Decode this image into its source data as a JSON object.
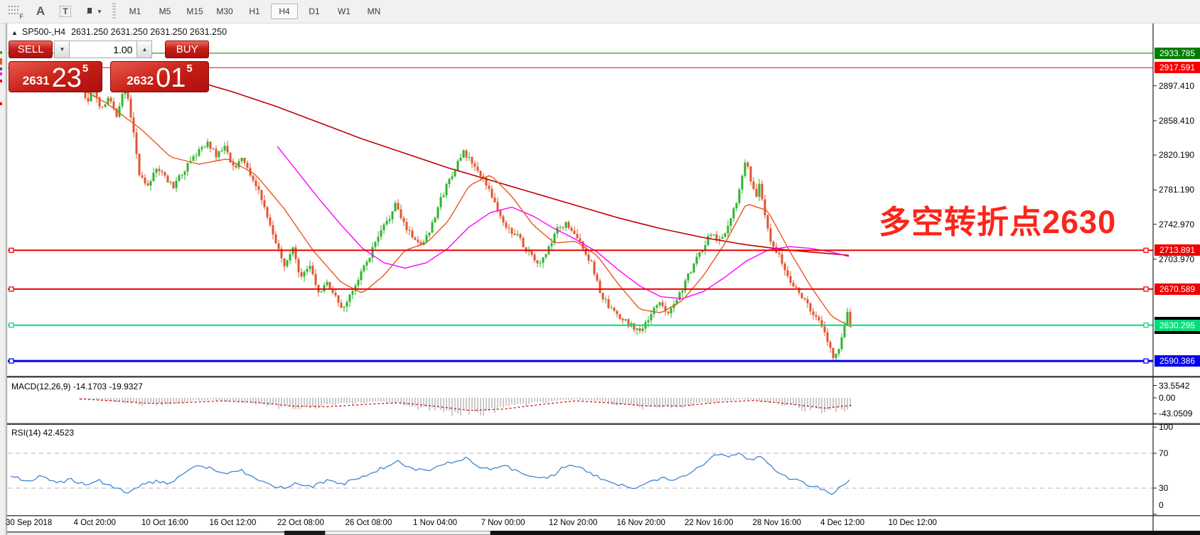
{
  "toolbar": {
    "icon_letters": {
      "f": "F",
      "a": "A",
      "t": "T"
    },
    "timeframes": [
      "M1",
      "M5",
      "M15",
      "M30",
      "H1",
      "H4",
      "D1",
      "W1",
      "MN"
    ],
    "active_timeframe": "H4"
  },
  "header": {
    "collapse_arrow": "▲",
    "symbol": "SP500-,H4",
    "ohlc_text": "2631.250 2631.250 2631.250 2631.250"
  },
  "trade_panel": {
    "sell_label": "SELL",
    "buy_label": "BUY",
    "volume": "1.00",
    "sell_price": {
      "prefix": "2631",
      "big": "23",
      "sup": "5"
    },
    "buy_price": {
      "prefix": "2632",
      "big": "01",
      "sup": "5"
    }
  },
  "annotation": {
    "text": "多空转折点2630",
    "color": "#fa261c"
  },
  "indicators": {
    "macd_label": "MACD(12,26,9) -14.1703 -19.9327",
    "rsi_label": "RSI(14) 42.4523"
  },
  "axes": {
    "price_ticks": [
      {
        "label": "2897.410",
        "price": 2897.41
      },
      {
        "label": "2858.410",
        "price": 2858.41
      },
      {
        "label": "2820.190",
        "price": 2820.19
      },
      {
        "label": "2781.190",
        "price": 2781.19
      },
      {
        "label": "2742.970",
        "price": 2742.97
      },
      {
        "label": "2703.970",
        "price": 2703.97
      }
    ],
    "price_badges": [
      {
        "label": "2933.785",
        "price": 2933.785,
        "color": "#007d00"
      },
      {
        "label": "2917.591",
        "price": 2917.591,
        "color": "#f40000"
      },
      {
        "label": "2713.891",
        "price": 2713.891,
        "color": "#ee0000"
      },
      {
        "label": "2670.589",
        "price": 2670.589,
        "color": "#ee0000"
      },
      {
        "label": "2630.295",
        "price": 2630.295,
        "color": "#00df7d",
        "backplate": true
      },
      {
        "label": "2590.386",
        "price": 2590.386,
        "color": "#0000ee"
      }
    ],
    "macd_ticks": [
      {
        "label": "33.5542",
        "value": 33.5542
      },
      {
        "label": "0.00",
        "value": 0
      },
      {
        "label": "-43.0509",
        "value": -43.0509
      }
    ],
    "rsi_ticks": [
      {
        "label": "100",
        "value": 100
      },
      {
        "label": "70",
        "value": 70
      },
      {
        "label": "30",
        "value": 30
      },
      {
        "label": "0",
        "value": 0
      }
    ],
    "dates": [
      "30 Sep 2018",
      "4 Oct 20:00",
      "10 Oct 16:00",
      "16 Oct 12:00",
      "22 Oct 08:00",
      "26 Oct 08:00",
      "1 Nov 04:00",
      "7 Nov 00:00",
      "12 Nov 20:00",
      "16 Nov 20:00",
      "22 Nov 16:00",
      "28 Nov 16:00",
      "4 Dec 12:00",
      "10 Dec 12:00"
    ]
  },
  "chart_data": {
    "type": "candlestick",
    "symbol": "SP500-",
    "timeframe": "H4",
    "last_price": 2631.25,
    "bid": 2631.235,
    "ask": 2632.015,
    "visible_price_range": [
      2573,
      2967
    ],
    "horizontal_levels": [
      {
        "price": 2933.785,
        "color": "#007d00",
        "width": 1,
        "handles": false
      },
      {
        "price": 2917.591,
        "color": "#f40000",
        "width": 1,
        "handles": false
      },
      {
        "price": 2713.891,
        "color": "#ee0000",
        "width": 2,
        "handles": true
      },
      {
        "price": 2670.589,
        "color": "#ee0000",
        "width": 2,
        "handles": true
      },
      {
        "price": 2630.295,
        "color": "#00df7d",
        "width": 2,
        "handles": true
      },
      {
        "price": 2590.386,
        "color": "#0000ee",
        "width": 3,
        "handles": true
      }
    ],
    "colors": {
      "up": "#2eb32e",
      "down": "#e2552e",
      "ma_fast": "#e8581e",
      "ma_mid": "#ff00ff",
      "ma_slow": "#c00000",
      "macd_hist": "#bcbcbc",
      "macd_signal": "#d40000",
      "rsi": "#3f86d2",
      "rsi_level": "#b5b5b5"
    },
    "price_path": [
      [
        112,
        2914
      ],
      [
        122,
        2880
      ],
      [
        132,
        2892
      ],
      [
        142,
        2870
      ],
      [
        152,
        2886
      ],
      [
        164,
        2866
      ],
      [
        176,
        2900
      ],
      [
        186,
        2856
      ],
      [
        196,
        2798
      ],
      [
        208,
        2788
      ],
      [
        220,
        2806
      ],
      [
        232,
        2794
      ],
      [
        244,
        2786
      ],
      [
        256,
        2800
      ],
      [
        268,
        2812
      ],
      [
        280,
        2826
      ],
      [
        292,
        2832
      ],
      [
        304,
        2820
      ],
      [
        316,
        2828
      ],
      [
        328,
        2806
      ],
      [
        340,
        2816
      ],
      [
        352,
        2798
      ],
      [
        364,
        2782
      ],
      [
        376,
        2748
      ],
      [
        388,
        2722
      ],
      [
        400,
        2696
      ],
      [
        412,
        2714
      ],
      [
        424,
        2682
      ],
      [
        436,
        2696
      ],
      [
        448,
        2666
      ],
      [
        460,
        2680
      ],
      [
        472,
        2660
      ],
      [
        484,
        2648
      ],
      [
        496,
        2670
      ],
      [
        508,
        2690
      ],
      [
        520,
        2708
      ],
      [
        532,
        2728
      ],
      [
        544,
        2746
      ],
      [
        556,
        2764
      ],
      [
        568,
        2744
      ],
      [
        580,
        2730
      ],
      [
        592,
        2720
      ],
      [
        604,
        2736
      ],
      [
        616,
        2762
      ],
      [
        628,
        2786
      ],
      [
        640,
        2806
      ],
      [
        652,
        2822
      ],
      [
        664,
        2812
      ],
      [
        676,
        2796
      ],
      [
        688,
        2784
      ],
      [
        700,
        2758
      ],
      [
        712,
        2738
      ],
      [
        724,
        2734
      ],
      [
        736,
        2720
      ],
      [
        748,
        2706
      ],
      [
        760,
        2698
      ],
      [
        772,
        2716
      ],
      [
        784,
        2736
      ],
      [
        796,
        2744
      ],
      [
        808,
        2730
      ],
      [
        820,
        2718
      ],
      [
        832,
        2698
      ],
      [
        844,
        2668
      ],
      [
        856,
        2650
      ],
      [
        868,
        2640
      ],
      [
        880,
        2634
      ],
      [
        892,
        2628
      ],
      [
        904,
        2624
      ],
      [
        916,
        2644
      ],
      [
        928,
        2654
      ],
      [
        940,
        2646
      ],
      [
        952,
        2660
      ],
      [
        964,
        2678
      ],
      [
        976,
        2698
      ],
      [
        988,
        2716
      ],
      [
        1000,
        2734
      ],
      [
        1012,
        2724
      ],
      [
        1024,
        2742
      ],
      [
        1036,
        2770
      ],
      [
        1044,
        2800
      ],
      [
        1050,
        2814
      ],
      [
        1056,
        2794
      ],
      [
        1062,
        2772
      ],
      [
        1068,
        2786
      ],
      [
        1074,
        2760
      ],
      [
        1082,
        2730
      ],
      [
        1092,
        2714
      ],
      [
        1102,
        2698
      ],
      [
        1112,
        2680
      ],
      [
        1122,
        2670
      ],
      [
        1132,
        2658
      ],
      [
        1142,
        2644
      ],
      [
        1152,
        2634
      ],
      [
        1160,
        2622
      ],
      [
        1168,
        2604
      ],
      [
        1174,
        2590
      ],
      [
        1182,
        2612
      ],
      [
        1190,
        2640
      ],
      [
        1195,
        2650
      ],
      [
        1198,
        2631
      ]
    ],
    "ma_fast": [
      [
        112,
        2895
      ],
      [
        150,
        2878
      ],
      [
        200,
        2848
      ],
      [
        240,
        2818
      ],
      [
        280,
        2810
      ],
      [
        320,
        2816
      ],
      [
        360,
        2798
      ],
      [
        400,
        2760
      ],
      [
        440,
        2714
      ],
      [
        480,
        2678
      ],
      [
        510,
        2666
      ],
      [
        540,
        2686
      ],
      [
        570,
        2714
      ],
      [
        600,
        2722
      ],
      [
        630,
        2746
      ],
      [
        660,
        2786
      ],
      [
        690,
        2798
      ],
      [
        720,
        2774
      ],
      [
        750,
        2742
      ],
      [
        780,
        2722
      ],
      [
        810,
        2724
      ],
      [
        840,
        2708
      ],
      [
        870,
        2676
      ],
      [
        900,
        2648
      ],
      [
        930,
        2644
      ],
      [
        960,
        2658
      ],
      [
        990,
        2686
      ],
      [
        1020,
        2722
      ],
      [
        1050,
        2766
      ],
      [
        1080,
        2758
      ],
      [
        1110,
        2714
      ],
      [
        1140,
        2674
      ],
      [
        1170,
        2640
      ],
      [
        1198,
        2628
      ]
    ],
    "ma_mid": [
      [
        390,
        2830
      ],
      [
        420,
        2800
      ],
      [
        450,
        2770
      ],
      [
        480,
        2742
      ],
      [
        510,
        2716
      ],
      [
        540,
        2700
      ],
      [
        570,
        2694
      ],
      [
        600,
        2700
      ],
      [
        630,
        2716
      ],
      [
        660,
        2740
      ],
      [
        690,
        2756
      ],
      [
        720,
        2762
      ],
      [
        750,
        2752
      ],
      [
        780,
        2738
      ],
      [
        810,
        2726
      ],
      [
        840,
        2712
      ],
      [
        870,
        2692
      ],
      [
        900,
        2674
      ],
      [
        930,
        2662
      ],
      [
        960,
        2660
      ],
      [
        990,
        2668
      ],
      [
        1020,
        2684
      ],
      [
        1050,
        2702
      ],
      [
        1080,
        2714
      ],
      [
        1110,
        2718
      ],
      [
        1140,
        2716
      ],
      [
        1170,
        2712
      ],
      [
        1198,
        2706
      ]
    ],
    "ma_slow": [
      [
        270,
        2904
      ],
      [
        330,
        2890
      ],
      [
        390,
        2874
      ],
      [
        450,
        2856
      ],
      [
        510,
        2838
      ],
      [
        570,
        2822
      ],
      [
        630,
        2806
      ],
      [
        690,
        2792
      ],
      [
        750,
        2778
      ],
      [
        810,
        2764
      ],
      [
        870,
        2750
      ],
      [
        930,
        2738
      ],
      [
        990,
        2728
      ],
      [
        1050,
        2720
      ],
      [
        1110,
        2714
      ],
      [
        1170,
        2710
      ],
      [
        1198,
        2708
      ]
    ],
    "macd": {
      "current_macd": -14.1703,
      "current_signal": -19.9327,
      "hist": [
        [
          112,
          -2
        ],
        [
          145,
          -6
        ],
        [
          175,
          -12
        ],
        [
          205,
          -18
        ],
        [
          235,
          -15
        ],
        [
          265,
          -9
        ],
        [
          295,
          -5
        ],
        [
          325,
          -9
        ],
        [
          355,
          -14
        ],
        [
          385,
          -22
        ],
        [
          415,
          -27
        ],
        [
          445,
          -25
        ],
        [
          475,
          -20
        ],
        [
          505,
          -14
        ],
        [
          535,
          -10
        ],
        [
          565,
          -16
        ],
        [
          595,
          -28
        ],
        [
          625,
          -38
        ],
        [
          655,
          -42
        ],
        [
          685,
          -36
        ],
        [
          715,
          -26
        ],
        [
          745,
          -16
        ],
        [
          775,
          -8
        ],
        [
          805,
          -4
        ],
        [
          835,
          -8
        ],
        [
          865,
          -16
        ],
        [
          895,
          -24
        ],
        [
          925,
          -26
        ],
        [
          955,
          -22
        ],
        [
          985,
          -16
        ],
        [
          1015,
          -8
        ],
        [
          1045,
          -4
        ],
        [
          1075,
          -10
        ],
        [
          1105,
          -20
        ],
        [
          1135,
          -30
        ],
        [
          1165,
          -36
        ],
        [
          1185,
          -30
        ],
        [
          1198,
          -26
        ]
      ],
      "signal": [
        [
          112,
          -3
        ],
        [
          160,
          -8
        ],
        [
          210,
          -15
        ],
        [
          260,
          -13
        ],
        [
          310,
          -8
        ],
        [
          360,
          -12
        ],
        [
          410,
          -22
        ],
        [
          460,
          -24
        ],
        [
          510,
          -18
        ],
        [
          560,
          -13
        ],
        [
          610,
          -22
        ],
        [
          660,
          -34
        ],
        [
          710,
          -30
        ],
        [
          760,
          -18
        ],
        [
          810,
          -8
        ],
        [
          860,
          -14
        ],
        [
          910,
          -22
        ],
        [
          960,
          -22
        ],
        [
          1010,
          -12
        ],
        [
          1060,
          -7
        ],
        [
          1110,
          -16
        ],
        [
          1160,
          -28
        ],
        [
          1198,
          -20
        ]
      ]
    },
    "rsi": {
      "current": 42.4523,
      "levels": [
        70,
        30
      ],
      "path": [
        [
          15,
          45
        ],
        [
          40,
          38
        ],
        [
          60,
          44
        ],
        [
          80,
          35
        ],
        [
          100,
          40
        ],
        [
          120,
          34
        ],
        [
          140,
          38
        ],
        [
          160,
          30
        ],
        [
          180,
          26
        ],
        [
          200,
          34
        ],
        [
          220,
          38
        ],
        [
          240,
          36
        ],
        [
          260,
          48
        ],
        [
          280,
          56
        ],
        [
          300,
          52
        ],
        [
          320,
          46
        ],
        [
          340,
          50
        ],
        [
          360,
          42
        ],
        [
          380,
          34
        ],
        [
          400,
          30
        ],
        [
          420,
          36
        ],
        [
          440,
          32
        ],
        [
          460,
          38
        ],
        [
          480,
          34
        ],
        [
          500,
          40
        ],
        [
          520,
          46
        ],
        [
          540,
          54
        ],
        [
          560,
          60
        ],
        [
          580,
          52
        ],
        [
          600,
          50
        ],
        [
          620,
          56
        ],
        [
          640,
          62
        ],
        [
          655,
          64
        ],
        [
          670,
          56
        ],
        [
          690,
          52
        ],
        [
          710,
          56
        ],
        [
          730,
          48
        ],
        [
          750,
          44
        ],
        [
          770,
          40
        ],
        [
          790,
          52
        ],
        [
          810,
          56
        ],
        [
          830,
          48
        ],
        [
          850,
          38
        ],
        [
          870,
          34
        ],
        [
          890,
          30
        ],
        [
          910,
          36
        ],
        [
          930,
          42
        ],
        [
          950,
          40
        ],
        [
          970,
          48
        ],
        [
          990,
          58
        ],
        [
          1010,
          70
        ],
        [
          1025,
          66
        ],
        [
          1040,
          72
        ],
        [
          1055,
          62
        ],
        [
          1070,
          66
        ],
        [
          1085,
          56
        ],
        [
          1100,
          44
        ],
        [
          1115,
          40
        ],
        [
          1130,
          36
        ],
        [
          1145,
          32
        ],
        [
          1160,
          28
        ],
        [
          1172,
          22
        ],
        [
          1182,
          32
        ],
        [
          1192,
          38
        ],
        [
          1198,
          42
        ]
      ]
    }
  }
}
